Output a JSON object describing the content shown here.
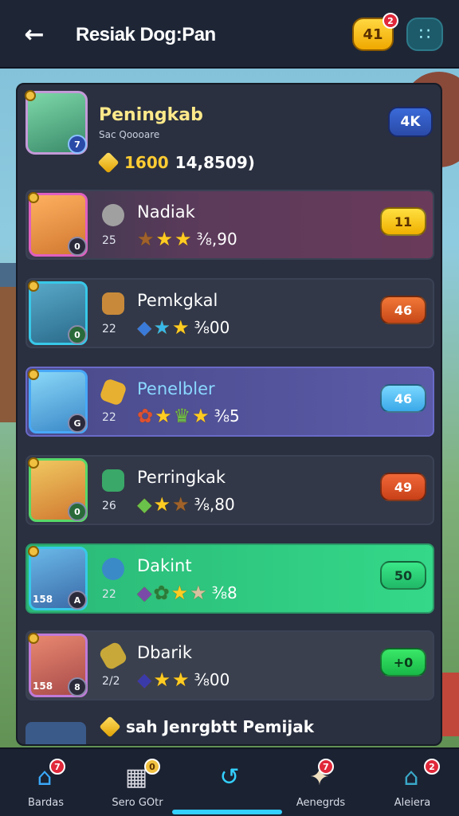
{
  "header": {
    "title": "Resiak Dog:Pan",
    "coins": "41",
    "coins_notification": "2"
  },
  "player": {
    "name": "Peningkab",
    "subtitle": "Sac Qoooare",
    "gold": "1600",
    "score": "14,8509)",
    "badge": "4K",
    "level": "7"
  },
  "rows": [
    {
      "name": "Nadiak",
      "rank": "25",
      "score": "⅜,90",
      "badge": "11",
      "level": "0"
    },
    {
      "name": "Pemkgkal",
      "rank": "22",
      "score": "⅜00",
      "badge": "46",
      "level": "0"
    },
    {
      "name": "Penelbler",
      "rank": "22",
      "score": "⅜5",
      "badge": "46",
      "level": "G"
    },
    {
      "name": "Perringkak",
      "rank": "26",
      "score": "⅜,80",
      "badge": "49",
      "level": "0"
    },
    {
      "name": "Dakint",
      "rank": "22",
      "score": "⅜8",
      "badge": "50",
      "level": "A",
      "avatar_tag": "158"
    },
    {
      "name": "Dbarik",
      "rank": "2/2",
      "score": "⅜00",
      "badge": "+0",
      "level": "8",
      "avatar_tag": "158"
    }
  ],
  "footer": {
    "text": "sah Jenrgbtt Pemijak"
  },
  "nav": [
    {
      "label": "Bardas",
      "icon": "home-icon",
      "badge": "7"
    },
    {
      "label": "Sero GOtr",
      "icon": "box-icon",
      "badge": "0"
    },
    {
      "label": "",
      "icon": "swap-icon",
      "badge": ""
    },
    {
      "label": "Aenegrds",
      "icon": "star-icon",
      "badge": "7"
    },
    {
      "label": "Aleiera",
      "icon": "house-icon",
      "badge": "2"
    }
  ],
  "colors": {
    "topbar": "#1e2636",
    "panel": "#2a3040",
    "accent_cyan": "#34d0ff",
    "gold": "#ffcc33"
  }
}
